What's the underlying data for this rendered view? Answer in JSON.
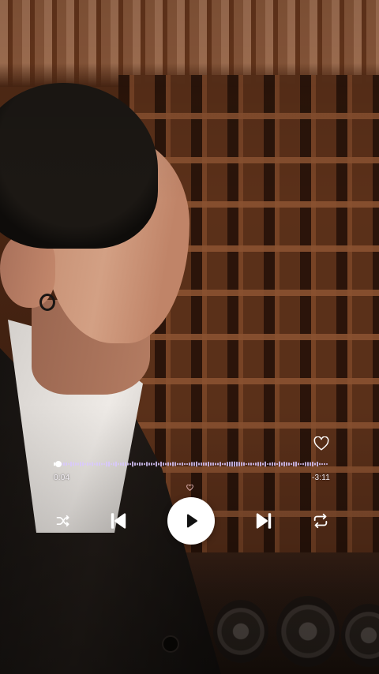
{
  "player": {
    "elapsed_time": "0:04",
    "remaining_time": "-3:11",
    "progress_fraction": 0.02,
    "accent_color": "#d9c8ff",
    "icons": {
      "like": "heart-outline-icon",
      "shuffle": "shuffle-icon",
      "previous": "skip-previous-icon",
      "play": "play-icon",
      "next": "skip-next-icon",
      "repeat": "repeat-icon"
    }
  }
}
